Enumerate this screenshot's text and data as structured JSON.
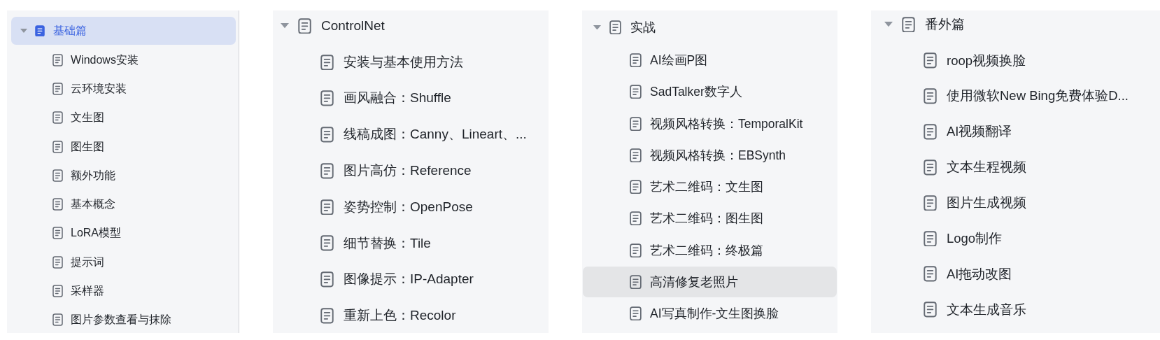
{
  "panels": [
    {
      "header": {
        "label": "基础篇",
        "selected": true,
        "expanded": true
      },
      "items": [
        {
          "label": "Windows安装",
          "highlighted": false
        },
        {
          "label": "云环境安装",
          "highlighted": false
        },
        {
          "label": "文生图",
          "highlighted": false
        },
        {
          "label": "图生图",
          "highlighted": false
        },
        {
          "label": "额外功能",
          "highlighted": false
        },
        {
          "label": "基本概念",
          "highlighted": false
        },
        {
          "label": "LoRA模型",
          "highlighted": false
        },
        {
          "label": "提示词",
          "highlighted": false
        },
        {
          "label": "采样器",
          "highlighted": false
        },
        {
          "label": "图片参数查看与抹除",
          "highlighted": false
        }
      ]
    },
    {
      "header": {
        "label": "ControlNet",
        "selected": false,
        "expanded": true
      },
      "items": [
        {
          "label": "安装与基本使用方法",
          "highlighted": false
        },
        {
          "label": "画风融合：Shuffle",
          "highlighted": false
        },
        {
          "label": "线稿成图：Canny、Lineart、...",
          "highlighted": false
        },
        {
          "label": "图片高仿：Reference",
          "highlighted": false
        },
        {
          "label": "姿势控制：OpenPose",
          "highlighted": false
        },
        {
          "label": "细节替换：Tile",
          "highlighted": false
        },
        {
          "label": "图像提示：IP-Adapter",
          "highlighted": false
        },
        {
          "label": "重新上色：Recolor",
          "highlighted": false
        }
      ]
    },
    {
      "header": {
        "label": "实战",
        "selected": false,
        "expanded": true
      },
      "items": [
        {
          "label": "AI绘画P图",
          "highlighted": false
        },
        {
          "label": "SadTalker数字人",
          "highlighted": false
        },
        {
          "label": "视频风格转换：TemporalKit",
          "highlighted": false
        },
        {
          "label": "视频风格转换：EBSynth",
          "highlighted": false
        },
        {
          "label": "艺术二维码：文生图",
          "highlighted": false
        },
        {
          "label": "艺术二维码：图生图",
          "highlighted": false
        },
        {
          "label": "艺术二维码：终极篇",
          "highlighted": false
        },
        {
          "label": "高清修复老照片",
          "highlighted": true
        },
        {
          "label": "AI写真制作-文生图换脸",
          "highlighted": false
        }
      ]
    },
    {
      "header": {
        "label": "番外篇",
        "selected": false,
        "expanded": true
      },
      "items": [
        {
          "label": "roop视频换脸",
          "highlighted": false
        },
        {
          "label": "使用微软New Bing免费体验D...",
          "highlighted": false
        },
        {
          "label": "AI视频翻译",
          "highlighted": false
        },
        {
          "label": "文本生程视频",
          "highlighted": false
        },
        {
          "label": "图片生成视频",
          "highlighted": false
        },
        {
          "label": "Logo制作",
          "highlighted": false
        },
        {
          "label": "AI拖动改图",
          "highlighted": false
        },
        {
          "label": "文本生成音乐",
          "highlighted": false
        }
      ]
    }
  ]
}
